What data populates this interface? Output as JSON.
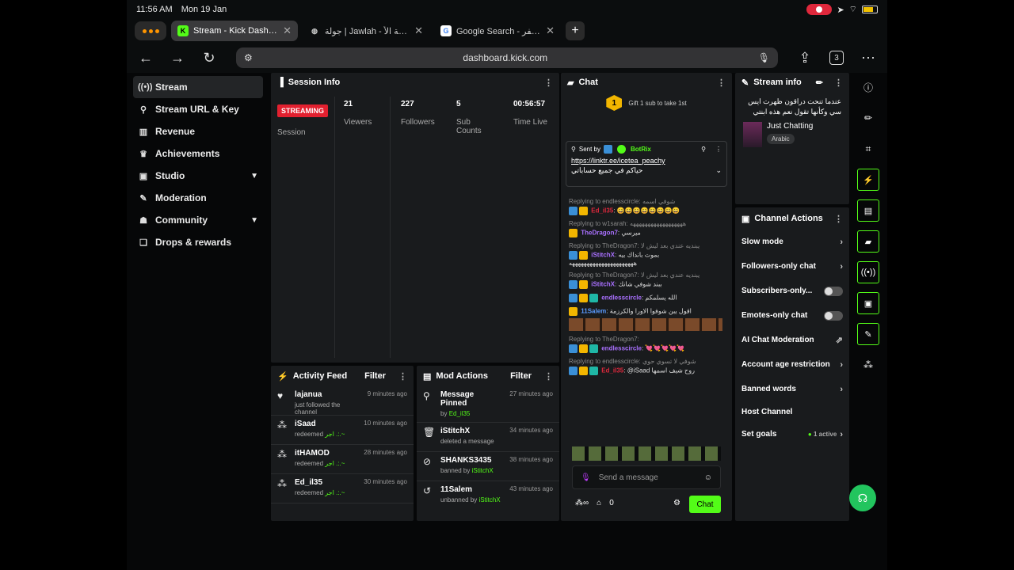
{
  "status_bar": {
    "time": "11:56 AM",
    "date": "Mon 19 Jan"
  },
  "tabs": [
    {
      "title": "Stream - Kick Dashboard",
      "favicon": "K",
      "favicon_color": "#53fc18",
      "active": true
    },
    {
      "title": "جولة | Jawlah - منصة الأ",
      "favicon": "globe-icon",
      "active": false
    },
    {
      "title": "Google Search - ح اصفر",
      "favicon": "G",
      "active": false
    }
  ],
  "address": {
    "url": "dashboard.kick.com",
    "tab_count": "3"
  },
  "sidebar": {
    "items": [
      {
        "label": "Stream",
        "icon": "broadcast-icon",
        "active": true
      },
      {
        "label": "Stream URL & Key",
        "icon": "link-icon"
      },
      {
        "label": "Revenue",
        "icon": "chart-icon"
      },
      {
        "label": "Achievements",
        "icon": "trophy-icon"
      },
      {
        "label": "Studio",
        "icon": "studio-icon",
        "expandable": true
      },
      {
        "label": "Moderation",
        "icon": "wrench-icon"
      },
      {
        "label": "Community",
        "icon": "people-icon",
        "expandable": true
      },
      {
        "label": "Drops & rewards",
        "icon": "gift-icon"
      }
    ]
  },
  "session": {
    "title": "Session Info",
    "badge": "STREAMING",
    "session_label": "Session",
    "stats": [
      {
        "value": "21",
        "label": "Viewers"
      },
      {
        "value": "227",
        "label": "Followers"
      },
      {
        "value": "5",
        "label": "Sub Counts"
      },
      {
        "value": "00:56:57",
        "label": "Time Live"
      }
    ]
  },
  "activity": {
    "title": "Activity Feed",
    "filter": "Filter",
    "items": [
      {
        "name": "lajanua",
        "text": "just followed the channel",
        "time": "9 minutes ago",
        "icon": "heart-icon"
      },
      {
        "name": "iSaad",
        "text": "redeemed",
        "reward": "اجر .:.~",
        "time": "10 minutes ago",
        "icon": "points-icon"
      },
      {
        "name": "itHAMOD",
        "text": "redeemed",
        "reward": "اجر .:.~",
        "time": "28 minutes ago",
        "icon": "points-icon"
      },
      {
        "name": "Ed_il35",
        "text": "redeemed",
        "reward": "اجر .:.~",
        "time": "30 minutes ago",
        "icon": "points-icon"
      }
    ]
  },
  "mod_actions": {
    "title": "Mod Actions",
    "filter": "Filter",
    "items": [
      {
        "action": "Message Pinned",
        "by_prefix": "by",
        "by": "Ed_il35",
        "time": "27 minutes ago",
        "icon": "pin-icon"
      },
      {
        "action": "iStitchX",
        "by_prefix": "deleted a message",
        "by": "",
        "time": "34 minutes ago",
        "icon": "trash-icon"
      },
      {
        "action": "SHANKS3435",
        "by_prefix": "banned by",
        "by": "iStitchX",
        "time": "38 minutes ago",
        "icon": "ban-icon"
      },
      {
        "action": "11Salem",
        "by_prefix": "unbanned by",
        "by": "iStitchX",
        "time": "43 minutes ago",
        "icon": "undo-icon"
      }
    ]
  },
  "chat": {
    "title": "Chat",
    "gift_rank": "1",
    "gift_text": "Gift 1 sub to take 1st",
    "pinned": {
      "sent_by": "Sent by",
      "author": "BotRix",
      "link": "https://linktr.ee/icetea_peachy",
      "text": "حياكم في جميع حساباتي"
    },
    "messages": [
      {
        "reply": "Replying to endlesscircle: شوفي اسمه",
        "user": "Ed_il35",
        "color": "#e0283c",
        "text": "😄😄😄😄😄😄😄😄"
      },
      {
        "reply": "Replying to w1sarah: ههههههههههههههههههه",
        "user": "TheDragon7",
        "color": "#a970ff",
        "text": "ميرسي"
      },
      {
        "reply": "Replying to TheDragon7: يبنديه عندي بعد ليش لا",
        "user": "iStitchX",
        "color": "#a970ff",
        "text": "بموت بانداك بيه ههههههههههههههههههههههه"
      },
      {
        "reply": "Replying to TheDragon7: يبنديه عندي بعد ليش لا",
        "user": "iStitchX",
        "color": "#a970ff",
        "text": "ببند شوفي شانك"
      },
      {
        "reply": "",
        "user": "endlesscircle",
        "color": "#a970ff",
        "text": "الله يسلمكم"
      },
      {
        "reply": "",
        "user": "11Salem",
        "color": "#5b9bff",
        "text": "اقول يبن شوفوا الاورا والكرزمة"
      },
      {
        "reply": "Replying to TheDragon7:",
        "user": "endlesscircle",
        "color": "#a970ff",
        "text": "💘💘💘💘💘"
      },
      {
        "reply": "Replying to endlesscircle: شوفي لا تسوي حوي",
        "user": "Ed_il35",
        "color": "#e0283c",
        "text": "@iSaad روح شيف اسمها"
      }
    ],
    "input_placeholder": "Send a message",
    "points": "0",
    "send_label": "Chat"
  },
  "stream_info": {
    "title": "Stream info",
    "stream_title": "عندما تنحت دراقون ظهرت ايس سي وكأنها تقول نعم هذه ابنتي",
    "category": "Just Chatting",
    "language": "Arabic"
  },
  "channel_actions": {
    "title": "Channel Actions",
    "items": [
      {
        "label": "Slow mode",
        "control": "chevron"
      },
      {
        "label": "Followers-only chat",
        "control": "chevron"
      },
      {
        "label": "Subscribers-only...",
        "control": "toggle"
      },
      {
        "label": "Emotes-only chat",
        "control": "toggle"
      },
      {
        "label": "AI Chat Moderation",
        "control": "external"
      },
      {
        "label": "Account age restriction",
        "control": "chevron"
      },
      {
        "label": "Banned words",
        "control": "chevron"
      },
      {
        "label": "Host Channel",
        "control": "none"
      },
      {
        "label": "Set goals",
        "control": "chevron",
        "status": "1 active"
      }
    ]
  },
  "colors": {
    "accent": "#53fc18",
    "live": "#e2202f",
    "panel": "#191b1d"
  }
}
